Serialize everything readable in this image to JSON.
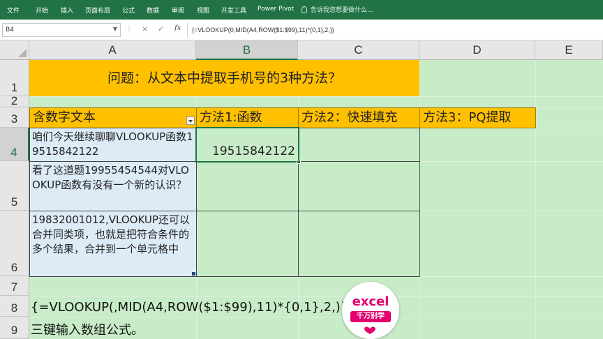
{
  "ribbon": {
    "tabs": [
      "文件",
      "开始",
      "插入",
      "页面布局",
      "公式",
      "数据",
      "审阅",
      "视图",
      "开发工具",
      "Power Pivot"
    ],
    "tell_me": "告诉我您想要做什么...",
    "icons": [
      "lightbulb-icon"
    ]
  },
  "formula_bar": {
    "name_box": "B4",
    "cancel_symbol": "×",
    "enter_symbol": "✓",
    "fx_label": "fx",
    "formula": "{=VLOOKUP(0,MID(A4,ROW($1:$99),11)*{0,1},2,)}"
  },
  "columns": [
    "A",
    "B",
    "C",
    "D",
    "E"
  ],
  "selected_column": "B",
  "rows": [
    "1",
    "2",
    "3",
    "4",
    "5",
    "6",
    "7",
    "8",
    "9"
  ],
  "selected_row": "4",
  "sheet": {
    "title": "问题：从文本中提取手机号的3种方法？",
    "headers": [
      "含数字文本",
      "方法1:函数",
      "方法2：快速填充",
      "方法3：PQ提取"
    ],
    "a4": "咱们今天继续聊聊VLOOKUP函数19515842122",
    "b4": "19515842122",
    "a5": "看了这道题19955454544对VLOOKUP函数有没有一个新的认识？",
    "a6": "19832001012,VLOOKUP还可以合并同类项，也就是把符合条件的多个结果，合并到一个单元格中",
    "row8_formula": "{=VLOOKUP(,MID(A4,ROW($1:$99),11)*{0,1},2,)}",
    "row9_note": "三键输入数组公式。"
  },
  "logo": {
    "word": "excel",
    "sub": "千万别学"
  },
  "colors": {
    "ribbon": "#217346",
    "sheet_bg": "#c9ecc8",
    "header_fill": "#ffc000",
    "text_cell_fill": "#ddebf7",
    "logo_pink": "#e3006e"
  }
}
